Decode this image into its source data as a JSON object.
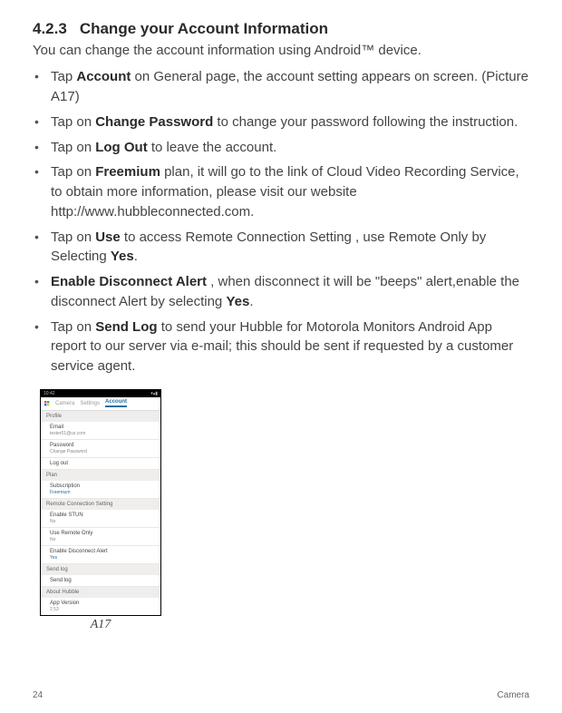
{
  "heading": {
    "number": "4.2.3",
    "title": "Change your Account Information"
  },
  "intro": "You can change the account information using Android™ device.",
  "bullets": [
    {
      "pre": "Tap ",
      "bold1": "Account",
      "mid": " on General page, the account setting appears on screen. (Picture A17)"
    },
    {
      "pre": "Tap on ",
      "bold1": "Change Password",
      "mid": " to change your password following the instruction."
    },
    {
      "pre": "Tap on ",
      "bold1": "Log Out",
      "mid": " to leave the account."
    },
    {
      "pre": "Tap on ",
      "bold1": "Freemium",
      "mid": " plan, it will go to the link of Cloud Video Recording Service, to obtain more information, please visit our website http://www.hubbleconnected.com."
    },
    {
      "pre": "Tap on ",
      "bold1": "Use",
      "mid": " to access Remote Connection Setting , use Remote Only by Selecting ",
      "bold2": "Yes",
      "post": "."
    },
    {
      "lead": "Enable Disconnect Alert",
      "mid": " , when disconnect it will be \"beeps\" alert,enable the disconnect Alert by selecting ",
      "bold2": "Yes",
      "post": "."
    },
    {
      "pre": "Tap on ",
      "bold1": "Send Log",
      "mid": " to send your Hubble for Motorola Monitors Android App report to our server via e-mail; this should be sent if requested by a customer service agent."
    }
  ],
  "phone": {
    "time": "10:42",
    "tabs": {
      "t1": "Camera",
      "t2": "Settings",
      "t3": "Account"
    },
    "s_profile": "Profile",
    "email_lbl": "Email",
    "email_val": "tester01@us.com",
    "pwd_lbl": "Password",
    "pwd_val": "Change Password",
    "logout": "Log out",
    "s_plan": "Plan",
    "sub_lbl": "Subscription",
    "sub_val": "Freemium",
    "s_remote": "Remote Connection Setting",
    "stun_lbl": "Enable STUN",
    "stun_val": "No",
    "remote_lbl": "Use Remote Only",
    "remote_val": "No",
    "disc_lbl": "Enable Disconnect Alert",
    "disc_val": "Yes",
    "s_sendlog": "Send log",
    "sendlog": "Send log",
    "s_about": "About Hubble",
    "ver_lbl": "App Version",
    "ver_val": "2.53"
  },
  "caption": "A17",
  "footer": {
    "page": "24",
    "section": "Camera"
  }
}
